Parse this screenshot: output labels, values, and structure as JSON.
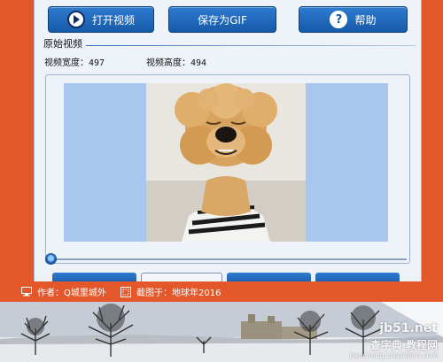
{
  "toolbar": {
    "open_label": "打开视频",
    "save_label": "保存为GIF",
    "help_label": "帮助"
  },
  "video_group": {
    "title": "原始视频",
    "width_label": "视频宽度：",
    "width_value": "497",
    "height_label": "视频高度：",
    "height_value": "494"
  },
  "player": {
    "progress": 0.0
  },
  "caption_bar": {
    "author_label": "作者：Q城里城外",
    "screenshot_label": "截图于：地球年2016"
  },
  "watermark": {
    "site": "jb51.net",
    "name": "查字典 教程网",
    "url": "jiaocheng.chazidian.com"
  },
  "colors": {
    "accent_orange": "#e4572b",
    "button_blue": "#1d65b8",
    "stage_blue": "#a8c6ee"
  }
}
